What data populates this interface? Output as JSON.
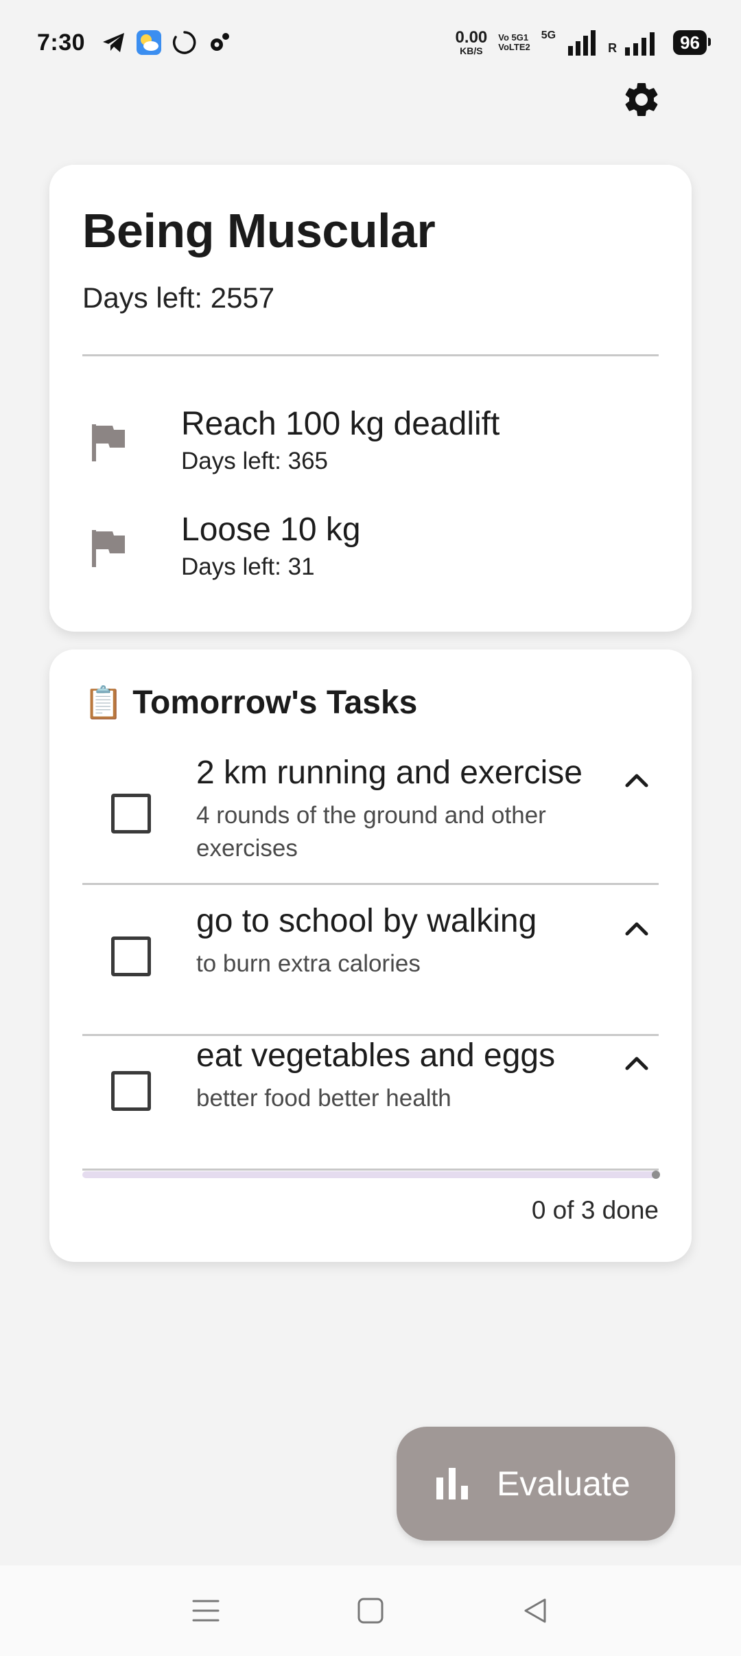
{
  "status_bar": {
    "time": "7:30",
    "net_speed_value": "0.00",
    "net_speed_unit": "KB/S",
    "volte_top": "Vo 5G1",
    "volte_bottom": "VoLTE2",
    "sig1_label": "5G",
    "sig2_label": "R",
    "battery": "96",
    "left_icons": [
      "telegram-icon",
      "weather-icon",
      "loading-ring-icon",
      "settings-small-icon"
    ]
  },
  "header": {
    "settings_icon": "gear-icon"
  },
  "goal": {
    "title": "Being Muscular",
    "days_left": "Days left: 2557",
    "milestones": [
      {
        "title": "Reach 100 kg deadlift",
        "days_left": "Days left: 365",
        "icon": "flag-icon"
      },
      {
        "title": "Loose 10 kg",
        "days_left": "Days left: 31",
        "icon": "flag-icon"
      }
    ]
  },
  "tasks": {
    "emoji": "📋",
    "title": "Tomorrow's Tasks",
    "items": [
      {
        "title": "2 km running and exercise",
        "description": "4  rounds of the ground and other exercises",
        "checked": false
      },
      {
        "title": "go to school by walking",
        "description": "to burn extra calories",
        "checked": false
      },
      {
        "title": "eat vegetables and eggs",
        "description": "better food better health",
        "checked": false
      }
    ],
    "progress_fraction": 0,
    "progress_text": "0 of 3 done"
  },
  "fab": {
    "label": "Evaluate",
    "icon": "bar-chart-icon"
  },
  "nav": {
    "buttons": [
      "menu-icon",
      "home-square-icon",
      "back-triangle-icon"
    ]
  },
  "colors": {
    "background": "#f3f3f3",
    "card": "#ffffff",
    "fab": "#a09896",
    "progress_track": "#e5dcef",
    "flag": "#8c8584"
  }
}
